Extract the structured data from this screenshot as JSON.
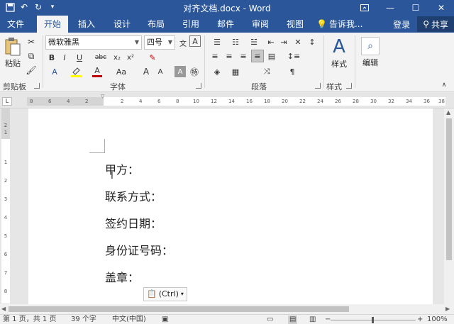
{
  "window": {
    "title": "对齐文档.docx - Word",
    "qat": [
      "save-icon",
      "undo-icon",
      "redo-icon",
      "customize-icon"
    ],
    "controls": [
      "minimize",
      "restore",
      "close"
    ]
  },
  "tabs": {
    "items": [
      "文件",
      "开始",
      "插入",
      "设计",
      "布局",
      "引用",
      "邮件",
      "审阅",
      "视图"
    ],
    "tell_me": "告诉我...",
    "login": "登录",
    "share": "共享"
  },
  "ribbon": {
    "clipboard": {
      "paste": "粘贴",
      "label": "剪贴板"
    },
    "font": {
      "name": "微软雅黑",
      "size": "四号",
      "label": "字体",
      "buttons": [
        "B",
        "I",
        "U",
        "abc",
        "x₂",
        "x²",
        "A",
        "A",
        "Aa",
        "A",
        "A",
        "A"
      ]
    },
    "paragraph": {
      "label": "段落"
    },
    "styles": {
      "button": "样式",
      "label": "样式"
    },
    "editing": {
      "button": "编辑"
    }
  },
  "ruler": {
    "corner": "L",
    "left_ticks": [
      "8",
      "6",
      "4",
      "2"
    ],
    "right_ticks": [
      "2",
      "4",
      "6",
      "8",
      "10",
      "12",
      "14",
      "16",
      "18",
      "20",
      "22",
      "24",
      "26",
      "28",
      "30",
      "32",
      "34",
      "36",
      "38"
    ],
    "vertical_ticks": [
      "2",
      "1",
      "1",
      "2",
      "3",
      "4",
      "5",
      "6",
      "7",
      "8"
    ]
  },
  "document": {
    "lines": [
      "甲方：",
      "联系方式：",
      "签约日期：",
      "身份证号码：",
      "盖章："
    ],
    "paste_options": "(Ctrl)"
  },
  "status_bar": {
    "page": "第 1 页，共 1 页",
    "words": "39 个字",
    "language": "中文(中国)",
    "zoom": "100%"
  },
  "colors": {
    "brand": "#2b579a",
    "ribbon_bg": "#f3f3f3",
    "font_color_bar": "#c00000",
    "highlight_bar": "#ffff00"
  }
}
